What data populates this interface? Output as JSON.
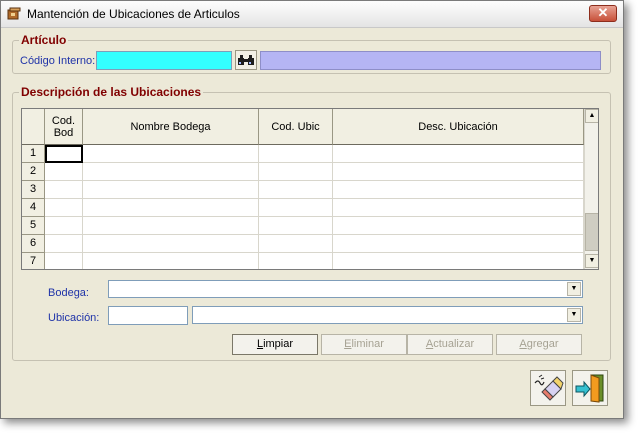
{
  "window": {
    "title": "Mantención de Ubicaciones de Articulos",
    "close_glyph": "✕"
  },
  "articulo": {
    "legend": "Artículo",
    "codigo_label": "Código Interno:",
    "codigo_value": "",
    "descripcion_value": ""
  },
  "ubicaciones": {
    "legend": "Descripción de las Ubicaciones",
    "columns": [
      "Cod.\nBod",
      "Nombre Bodega",
      "Cod. Ubic",
      "Desc. Ubicación"
    ],
    "rows": [
      "1",
      "2",
      "3",
      "4",
      "5",
      "6",
      "7"
    ],
    "bodega_label": "Bodega:",
    "bodega_value": "",
    "ubicacion_label": "Ubicación:",
    "ubicacion_code": "",
    "ubicacion_value": ""
  },
  "actions": {
    "limpiar_prefix": "L",
    "limpiar_rest": "impiar",
    "eliminar_prefix": "E",
    "eliminar_rest": "liminar",
    "actualizar_prefix": "A",
    "actualizar_rest": "ctualizar",
    "agregar_prefix": "A",
    "agregar_rest": "gregar"
  },
  "icons": {
    "app": "app-icon",
    "search": "binoculars-icon",
    "clear": "eraser-icon",
    "exit": "exit-door-icon"
  }
}
